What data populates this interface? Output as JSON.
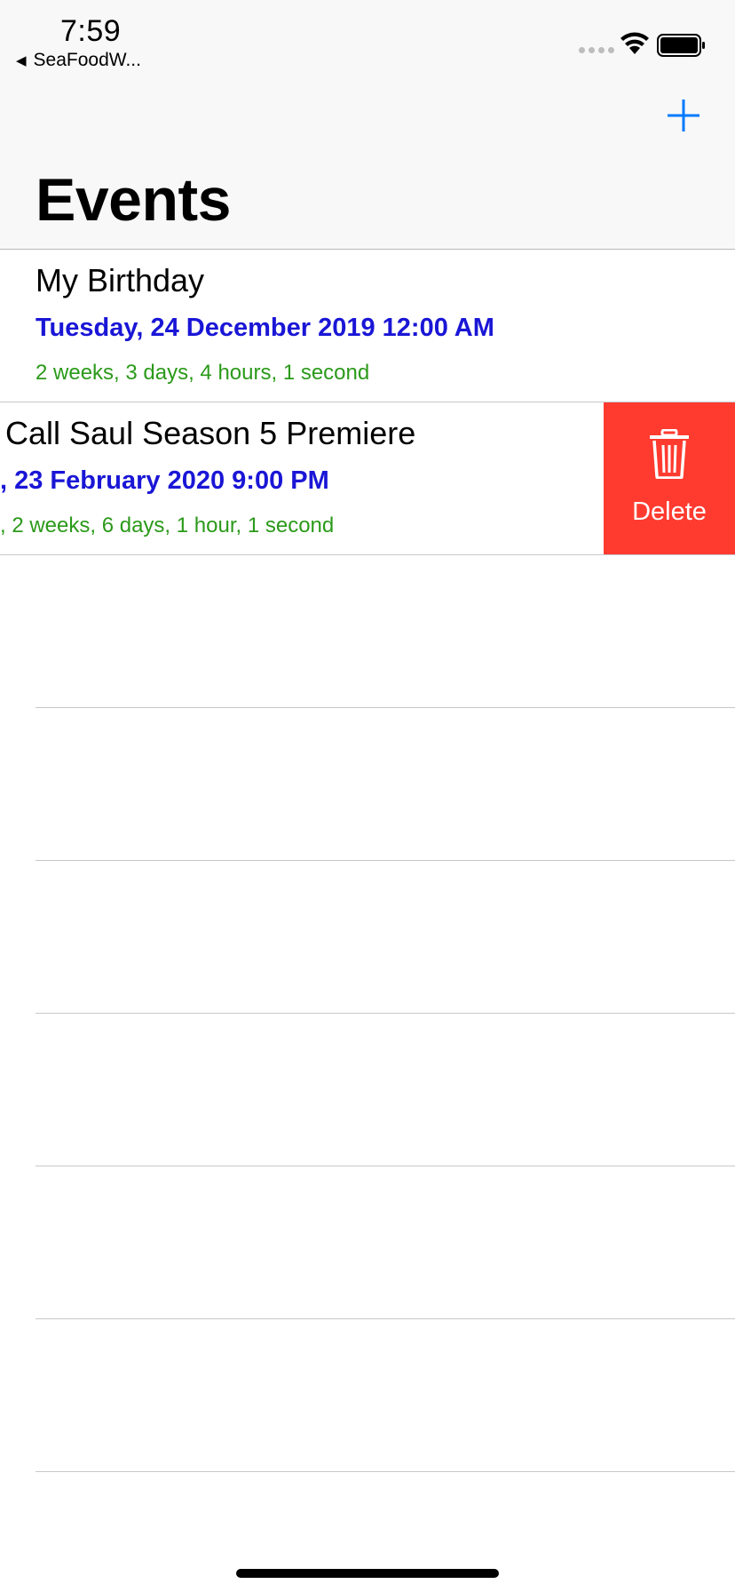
{
  "status": {
    "time": "7:59",
    "back_app": "SeaFoodW..."
  },
  "nav": {
    "title": "Events",
    "add_icon": "plus-icon"
  },
  "events": [
    {
      "title": "My Birthday",
      "date": "Tuesday, 24 December 2019 12:00 AM",
      "countdown": "2 weeks, 3 days, 4 hours, 1 second"
    },
    {
      "title": "Call Saul Season 5 Premiere",
      "date": ", 23 February 2020 9:00 PM",
      "countdown": ", 2 weeks, 6 days, 1 hour, 1 second"
    }
  ],
  "swipe_action": {
    "label": "Delete",
    "icon": "trash-icon",
    "color": "#ff3b30"
  },
  "colors": {
    "accent": "#007aff",
    "date_text": "#1a16d6",
    "countdown_text": "#2b9a1a"
  }
}
